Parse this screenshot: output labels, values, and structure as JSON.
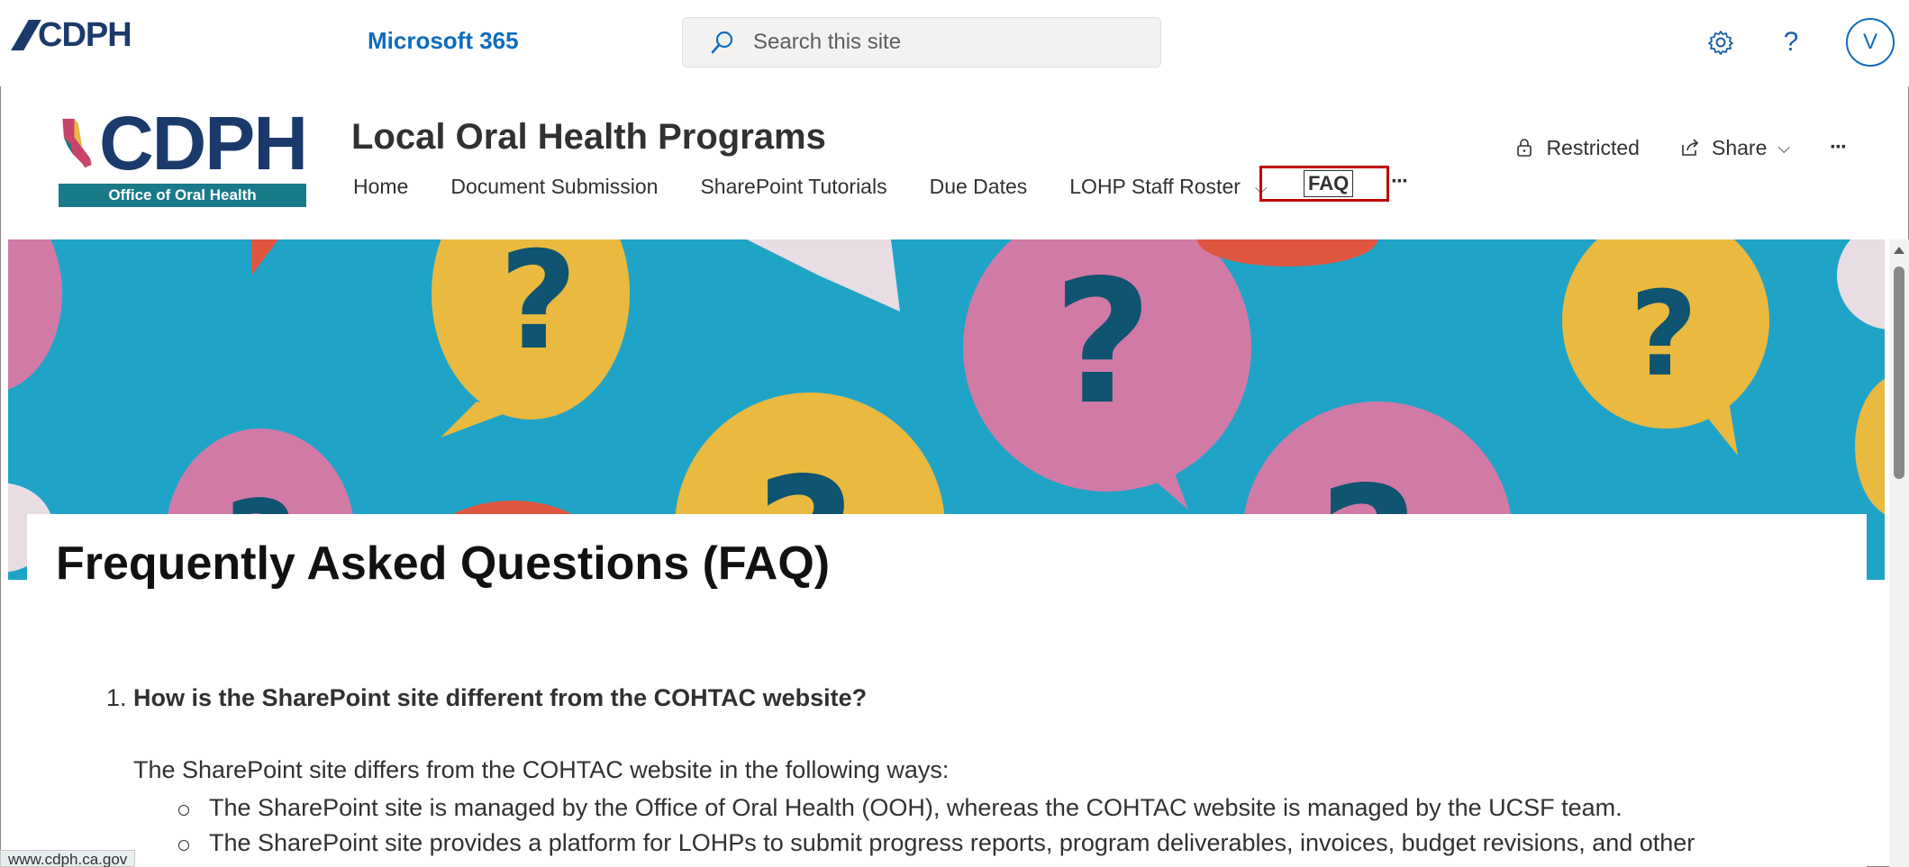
{
  "suite_bar": {
    "org_logo_text": "CDPH",
    "app_name": "Microsoft 365",
    "search_placeholder": "Search this site",
    "avatar_initial": "V"
  },
  "site": {
    "logo_text": "CDPH",
    "logo_subtitle": "Office of Oral Health",
    "title": "Local Oral Health Programs",
    "nav": [
      {
        "label": "Home"
      },
      {
        "label": "Document Submission"
      },
      {
        "label": "SharePoint Tutorials"
      },
      {
        "label": "Due Dates"
      },
      {
        "label": "LOHP Staff Roster"
      },
      {
        "label": "FAQ"
      }
    ],
    "actions": {
      "restricted": "Restricted",
      "share": "Share"
    }
  },
  "page": {
    "title": "Frequently Asked Questions (FAQ)",
    "question_1": {
      "number": "1.",
      "text": "How is the SharePoint site different from the COHTAC website?",
      "intro": "The SharePoint site differs from the COHTAC website in the following ways:",
      "bullets": [
        "The SharePoint site is managed by the Office of Oral Health (OOH), whereas the COHTAC website is managed by the UCSF team.",
        "The SharePoint site provides a platform for LOHPs to submit progress reports, program deliverables, invoices, budget revisions, and other"
      ]
    }
  },
  "status_bar": {
    "url": "www.cdph.ca.gov"
  },
  "colors": {
    "brand_navy": "#1a3a6b",
    "accent_blue": "#0f6cbd",
    "banner_teal": "#1fa4c8",
    "highlight_red": "#c00000"
  }
}
